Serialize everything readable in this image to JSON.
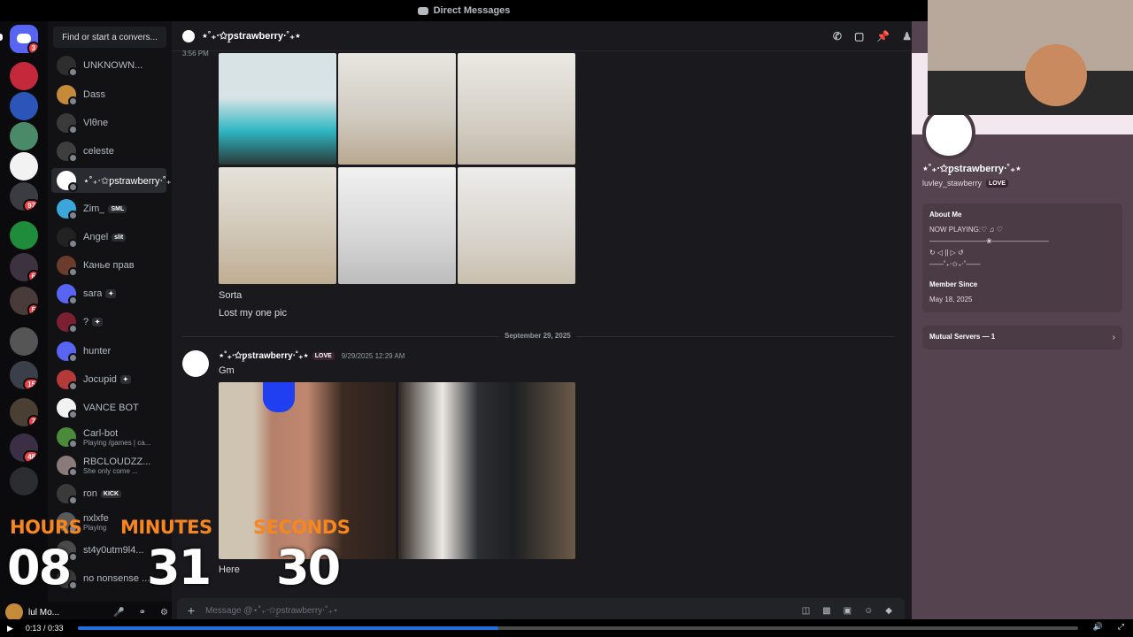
{
  "window": {
    "title": "Direct Messages"
  },
  "servers": {
    "home_badge": "3",
    "badges": [
      "97",
      "6",
      "5",
      "15",
      "7",
      "48"
    ]
  },
  "dm_list": {
    "search_placeholder": "Find or start a convers...",
    "items": [
      {
        "name": "UNKNOWN...",
        "sub": "",
        "tag": ""
      },
      {
        "name": "Dass",
        "sub": "",
        "tag": ""
      },
      {
        "name": "Vlθnе",
        "sub": "",
        "tag": ""
      },
      {
        "name": "celeste",
        "sub": "",
        "tag": ""
      },
      {
        "name": "⋆˚₊‧✩ƿ̱strawberry‧˚₊⋆...",
        "sub": "",
        "tag": ""
      },
      {
        "name": "Zim_",
        "sub": "",
        "tag": "SML"
      },
      {
        "name": "Angel",
        "sub": "",
        "tag": "slit"
      },
      {
        "name": "Канье прав",
        "sub": "",
        "tag": ""
      },
      {
        "name": "sara",
        "sub": "",
        "tag": "✦"
      },
      {
        "name": "?",
        "sub": "",
        "tag": "✦"
      },
      {
        "name": "hunter",
        "sub": "",
        "tag": ""
      },
      {
        "name": "Jocupid",
        "sub": "",
        "tag": "✦"
      },
      {
        "name": "VANCE BOT",
        "sub": "",
        "tag": ""
      },
      {
        "name": "Carl-bot",
        "sub": "Playing /games | ca...",
        "tag": ""
      },
      {
        "name": "RBCLOUDZZ...",
        "sub": "She only come ...",
        "tag": ""
      },
      {
        "name": "ron",
        "sub": "",
        "tag": "KICK"
      },
      {
        "name": "nxlxfe",
        "sub": "Playing",
        "tag": ""
      },
      {
        "name": "st4y0utm9l4...",
        "sub": "",
        "tag": ""
      },
      {
        "name": "no nonsense ...",
        "sub": "",
        "tag": ""
      }
    ]
  },
  "user_bar": {
    "name": "lul Mo...",
    "status": "Online"
  },
  "chat": {
    "header_name": "⋆˚₊‧✩ƿ̱strawberry‧˚₊⋆",
    "top_timestamp": "3:56 PM",
    "messages_before": [
      "Sorta",
      "Lost my one pic"
    ],
    "date_divider": "September 29, 2025",
    "author": "⋆˚₊‧✩ƿ̱strawberry‧˚₊⋆",
    "author_tag": "LOVE",
    "author_time": "9/29/2025 12:29 AM",
    "message_gm": "Gm",
    "message_here": "Here",
    "composer_placeholder": "Message @⋆˚₊‧✩ƿ̱strawberry‧˚₊⋆"
  },
  "profile": {
    "display_name": "⋆˚₊‧✩ƿ̱strawberry‧˚₊⋆",
    "username": "luvley_stawberry",
    "tag": "LOVE",
    "about_heading": "About Me",
    "about_text": "NOW PLAYING:♡ ♫ ♡\n————————❀————————\n↻ ◁ || ▷ ↺\n——˚₊‧✩₊‧˚——",
    "member_since_heading": "Member Since",
    "member_since": "May 18, 2025",
    "mutual_servers": "Mutual Servers — 1"
  },
  "timer": {
    "hours_label": "HOURS",
    "minutes_label": "MINUTES",
    "seconds_label": "SECONDS",
    "hours": "08",
    "minutes": "31",
    "seconds": "30"
  },
  "player": {
    "time": "0:13 / 0:33",
    "progress": 0.42
  }
}
